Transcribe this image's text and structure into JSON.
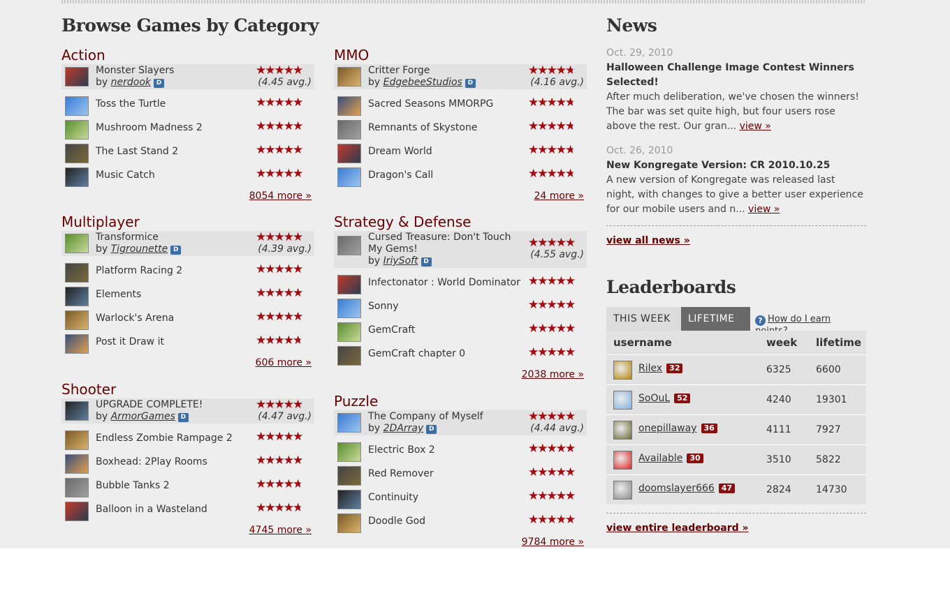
{
  "browse": {
    "title": "Browse Games by Category"
  },
  "categories": [
    {
      "title": "Action",
      "featured": {
        "name": "Monster Slayers",
        "by_label": "by",
        "author": "nerdook",
        "dev_badge": "D",
        "stars": 4.45,
        "avg": "(4.45 avg.)"
      },
      "games": [
        {
          "name": "Toss the Turtle",
          "stars": 4.5
        },
        {
          "name": "Mushroom Madness 2",
          "stars": 4.5
        },
        {
          "name": "The Last Stand 2",
          "stars": 4.5
        },
        {
          "name": "Music Catch",
          "stars": 4.5
        }
      ],
      "more": "8054 more »"
    },
    {
      "title": "MMO",
      "featured": {
        "name": "Critter Forge",
        "by_label": "by",
        "author": "EdgebeeStudios",
        "dev_badge": "D",
        "stars": 4.0,
        "avg": "(4.16 avg.)"
      },
      "games": [
        {
          "name": "Sacred Seasons MMORPG",
          "stars": 4.0
        },
        {
          "name": "Remnants of Skystone",
          "stars": 4.0
        },
        {
          "name": "Dream World",
          "stars": 4.0
        },
        {
          "name": "Dragon's Call",
          "stars": 4.0
        }
      ],
      "more": "24 more »"
    },
    {
      "title": "Multiplayer",
      "featured": {
        "name": "Transformice",
        "by_label": "by",
        "author": "Tigrounette",
        "dev_badge": "D",
        "stars": 4.5,
        "avg": "(4.39 avg.)"
      },
      "games": [
        {
          "name": "Platform Racing 2",
          "stars": 4.5
        },
        {
          "name": "Elements",
          "stars": 4.5
        },
        {
          "name": "Warlock's Arena",
          "stars": 4.5
        },
        {
          "name": "Post it Draw it",
          "stars": 4.0
        }
      ],
      "more": "606 more »"
    },
    {
      "title": "Strategy & Defense",
      "featured": {
        "name": "Cursed Treasure: Don't Touch My Gems!",
        "by_label": "by",
        "author": "IriySoft",
        "dev_badge": "D",
        "stars": 4.5,
        "avg": "(4.55 avg.)"
      },
      "games": [
        {
          "name": "Infectonator : World Dominator",
          "stars": 4.5
        },
        {
          "name": "Sonny",
          "stars": 4.5
        },
        {
          "name": "GemCraft",
          "stars": 4.5
        },
        {
          "name": "GemCraft chapter 0",
          "stars": 4.5
        }
      ],
      "more": "2038 more »"
    },
    {
      "title": "Shooter",
      "featured": {
        "name": "UPGRADE COMPLETE!",
        "by_label": "by",
        "author": "ArmorGames",
        "dev_badge": "D",
        "stars": 4.5,
        "avg": "(4.47 avg.)"
      },
      "games": [
        {
          "name": "Endless Zombie Rampage 2",
          "stars": 4.5
        },
        {
          "name": "Boxhead: 2Play Rooms",
          "stars": 4.5
        },
        {
          "name": "Bubble Tanks 2",
          "stars": 4.0
        },
        {
          "name": "Balloon in a Wasteland",
          "stars": 4.0
        }
      ],
      "more": "4745 more »"
    },
    {
      "title": "Puzzle",
      "featured": {
        "name": "The Company of Myself",
        "by_label": "by",
        "author": "2DArray",
        "dev_badge": "D",
        "stars": 4.5,
        "avg": "(4.44 avg.)"
      },
      "games": [
        {
          "name": "Electric Box 2",
          "stars": 4.5
        },
        {
          "name": "Red Remover",
          "stars": 4.5
        },
        {
          "name": "Continuity",
          "stars": 4.5
        },
        {
          "name": "Doodle God",
          "stars": 4.5
        }
      ],
      "more": "9784 more »"
    }
  ],
  "news": {
    "title": "News",
    "items": [
      {
        "date": "Oct. 29, 2010",
        "title": "Halloween Challenge Image Contest Winners Selected!",
        "body": "After much deliberation, we've chosen the winners! The bar was set quite high, but four users rose above the rest. Our gran...",
        "link": "view »"
      },
      {
        "date": "Oct. 26, 2010",
        "title": "New Kongregate Version: CR 2010.10.25",
        "body": "A new version of Kongregate was released last night, with changes to give a better user experience for our mobile users and n...",
        "link": "view »"
      }
    ],
    "view_all": "view all news »"
  },
  "leaderboards": {
    "title": "Leaderboards",
    "tab_week": "THIS WEEK",
    "tab_lifetime": "LIFETIME",
    "help": "How do I earn points?",
    "help_icon": "?",
    "columns": {
      "username": "username",
      "week": "week",
      "lifetime": "lifetime"
    },
    "rows": [
      {
        "user": "Rilex",
        "level": "32",
        "week": "6325",
        "lifetime": "6600",
        "avatar_color": "#b8860b"
      },
      {
        "user": "SoOuL",
        "level": "52",
        "week": "4240",
        "lifetime": "19301",
        "avatar_color": "#7fb0e0"
      },
      {
        "user": "onepillaway",
        "level": "36",
        "week": "4111",
        "lifetime": "7927",
        "avatar_color": "#6b6b3a"
      },
      {
        "user": "Available",
        "level": "30",
        "week": "3510",
        "lifetime": "5822",
        "avatar_color": "#e02020"
      },
      {
        "user": "doomslayer666",
        "level": "47",
        "week": "2824",
        "lifetime": "14730",
        "avatar_color": "#8a8a8a"
      }
    ],
    "view_entire": "view entire leaderboard »"
  },
  "colors": {
    "accent": "#660000",
    "star": "#a30d12",
    "star_empty": "#bdbdbd",
    "dev_badge": "#3a6ea5",
    "level_badge": "#8a1010"
  }
}
